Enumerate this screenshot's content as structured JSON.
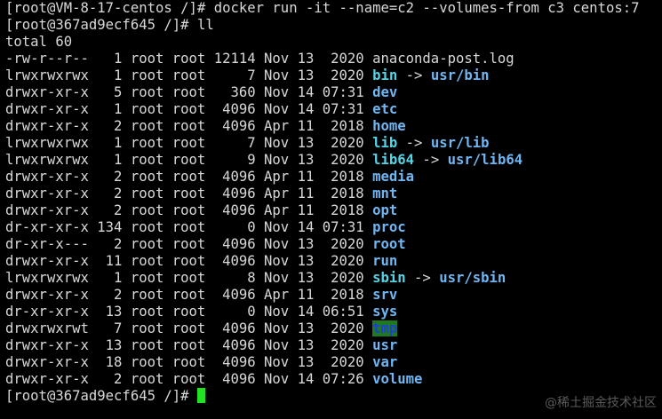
{
  "terminal": {
    "command_line": "[root@VM-8-17-centos /]# docker run -it --name=c2 --volumes-from c3 centos:7",
    "prompt2": "[root@367ad9ecf645 /]# ",
    "cmd2": "ll",
    "total": "total 60",
    "entries": [
      {
        "meta": "-rw-r--r--   1 root root 12114 Nov 13  2020 ",
        "name": "anaconda-post.log",
        "kind": "file",
        "target": ""
      },
      {
        "meta": "lrwxrwxrwx   1 root root     7 Nov 13  2020 ",
        "name": "bin",
        "kind": "link",
        "target": "usr/bin"
      },
      {
        "meta": "drwxr-xr-x   5 root root   360 Nov 14 07:31 ",
        "name": "dev",
        "kind": "dir",
        "target": ""
      },
      {
        "meta": "drwxr-xr-x   1 root root  4096 Nov 14 07:31 ",
        "name": "etc",
        "kind": "dir",
        "target": ""
      },
      {
        "meta": "drwxr-xr-x   2 root root  4096 Apr 11  2018 ",
        "name": "home",
        "kind": "dir",
        "target": ""
      },
      {
        "meta": "lrwxrwxrwx   1 root root     7 Nov 13  2020 ",
        "name": "lib",
        "kind": "link",
        "target": "usr/lib"
      },
      {
        "meta": "lrwxrwxrwx   1 root root     9 Nov 13  2020 ",
        "name": "lib64",
        "kind": "link",
        "target": "usr/lib64"
      },
      {
        "meta": "drwxr-xr-x   2 root root  4096 Apr 11  2018 ",
        "name": "media",
        "kind": "dir",
        "target": ""
      },
      {
        "meta": "drwxr-xr-x   2 root root  4096 Apr 11  2018 ",
        "name": "mnt",
        "kind": "dir",
        "target": ""
      },
      {
        "meta": "drwxr-xr-x   2 root root  4096 Apr 11  2018 ",
        "name": "opt",
        "kind": "dir",
        "target": ""
      },
      {
        "meta": "dr-xr-xr-x 134 root root     0 Nov 14 07:31 ",
        "name": "proc",
        "kind": "dir",
        "target": ""
      },
      {
        "meta": "dr-xr-x---   2 root root  4096 Nov 13  2020 ",
        "name": "root",
        "kind": "dir",
        "target": ""
      },
      {
        "meta": "drwxr-xr-x  11 root root  4096 Nov 13  2020 ",
        "name": "run",
        "kind": "dir",
        "target": ""
      },
      {
        "meta": "lrwxrwxrwx   1 root root     8 Nov 13  2020 ",
        "name": "sbin",
        "kind": "link",
        "target": "usr/sbin"
      },
      {
        "meta": "drwxr-xr-x   2 root root  4096 Apr 11  2018 ",
        "name": "srv",
        "kind": "dir",
        "target": ""
      },
      {
        "meta": "dr-xr-xr-x  13 root root     0 Nov 14 06:51 ",
        "name": "sys",
        "kind": "dir",
        "target": ""
      },
      {
        "meta": "drwxrwxrwt   7 root root  4096 Nov 13  2020 ",
        "name": "tmp",
        "kind": "sticky",
        "target": ""
      },
      {
        "meta": "drwxr-xr-x  13 root root  4096 Nov 13  2020 ",
        "name": "usr",
        "kind": "dir",
        "target": ""
      },
      {
        "meta": "drwxr-xr-x  18 root root  4096 Nov 13  2020 ",
        "name": "var",
        "kind": "dir",
        "target": ""
      },
      {
        "meta": "drwxr-xr-x   2 root root  4096 Nov 14 07:26 ",
        "name": "volume",
        "kind": "dir",
        "target": ""
      }
    ],
    "final_prompt": "[root@367ad9ecf645 /]# ",
    "arrow": " -> "
  },
  "watermark": "@稀土掘金技术社区",
  "colors": {
    "background": "#000000",
    "text": "#d8d8d8",
    "directory": "#6fb6f2",
    "symlink": "#55d4e6",
    "sticky_bg": "#1f7a1f",
    "cursor": "#22e022"
  }
}
